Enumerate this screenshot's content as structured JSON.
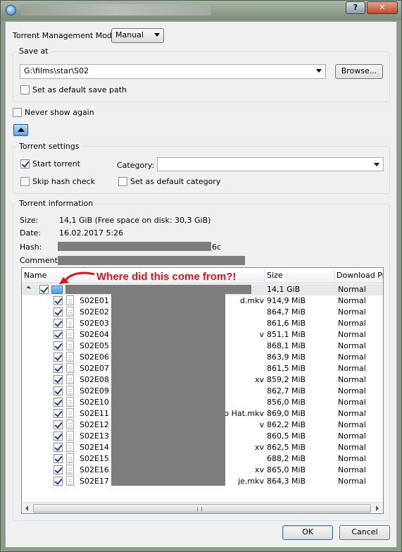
{
  "window": {
    "help_label": "?",
    "close_label": "✕"
  },
  "mode": {
    "label": "Torrent Management Mode:",
    "value": "Manual"
  },
  "save_at": {
    "group_title": "Save at",
    "path": "G:\\films\\star\\S02",
    "browse_label": "Browse...",
    "default_path_label": "Set as default save path",
    "default_path_checked": false
  },
  "never_show_label": "Never show again",
  "never_show_checked": false,
  "torrent_settings": {
    "group_title": "Torrent settings",
    "start_label": "Start torrent",
    "start_checked": true,
    "category_label": "Category:",
    "category_value": "",
    "skip_hash_label": "Skip hash check",
    "skip_hash_checked": false,
    "default_category_label": "Set as default category",
    "default_category_checked": false
  },
  "info": {
    "group_title": "Torrent information",
    "size_label": "Size:",
    "size_value": "14,1 GiB (Free space on disk: 30,3 GiB)",
    "date_label": "Date:",
    "date_value": "16.02.2017 5:26",
    "hash_label": "Hash:",
    "hash_suffix": "6c",
    "comment_label": "Comment:"
  },
  "tree": {
    "columns": [
      "Name",
      "Size",
      "Download Prio"
    ],
    "root": {
      "size": "14,1 GiB",
      "priority": "Normal",
      "checked": true
    },
    "files": [
      {
        "name": "S02E01",
        "tail": "d.mkv",
        "size": "914,9 MiB",
        "priority": "Normal"
      },
      {
        "name": "S02E02",
        "tail": "",
        "size": "864,7 MiB",
        "priority": "Normal"
      },
      {
        "name": "S02E03",
        "tail": "",
        "size": "861,6 MiB",
        "priority": "Normal"
      },
      {
        "name": "S02E04",
        "tail": "v",
        "size": "851,1 MiB",
        "priority": "Normal"
      },
      {
        "name": "S02E05",
        "tail": "",
        "size": "868,1 MiB",
        "priority": "Normal"
      },
      {
        "name": "S02E06",
        "tail": "",
        "size": "863,9 MiB",
        "priority": "Normal"
      },
      {
        "name": "S02E07",
        "tail": "",
        "size": "861,5 MiB",
        "priority": "Normal"
      },
      {
        "name": "S02E08",
        "tail": "xv",
        "size": "859,2 MiB",
        "priority": "Normal"
      },
      {
        "name": "S02E09",
        "tail": "",
        "size": "862,7 MiB",
        "priority": "Normal"
      },
      {
        "name": "S02E10",
        "tail": "",
        "size": "856,0 MiB",
        "priority": "Normal"
      },
      {
        "name": "S02E11",
        "tail": "o Hat.mkv",
        "size": "869,0 MiB",
        "priority": "Normal"
      },
      {
        "name": "S02E12",
        "tail": "v",
        "size": "862,2 MiB",
        "priority": "Normal"
      },
      {
        "name": "S02E13",
        "tail": "",
        "size": "860,5 MiB",
        "priority": "Normal"
      },
      {
        "name": "S02E14",
        "tail": "xv",
        "size": "862,5 MiB",
        "priority": "Normal"
      },
      {
        "name": "S02E15",
        "tail": "",
        "size": "688,2 MiB",
        "priority": "Normal"
      },
      {
        "name": "S02E16",
        "tail": "xv",
        "size": "865,0 MiB",
        "priority": "Normal"
      },
      {
        "name": "S02E17",
        "tail": "je.mkv",
        "size": "864,3 MiB",
        "priority": "Normal"
      }
    ]
  },
  "annotation": "Where did this come from?!",
  "ok_label": "OK",
  "cancel_label": "Cancel"
}
